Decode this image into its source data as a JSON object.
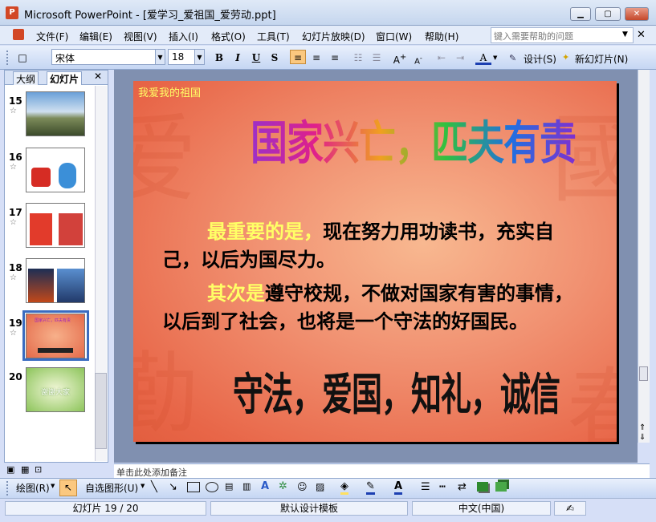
{
  "window": {
    "title": "Microsoft PowerPoint - [爱学习_爱祖国_爱劳动.ppt]",
    "app_icon": "P"
  },
  "menus": [
    "文件(F)",
    "编辑(E)",
    "视图(V)",
    "插入(I)",
    "格式(O)",
    "工具(T)",
    "幻灯片放映(D)",
    "窗口(W)",
    "帮助(H)"
  ],
  "help": {
    "placeholder": "键入需要帮助的问题"
  },
  "toolbar": {
    "font": "宋体",
    "size": "18",
    "bold": "B",
    "italic": "I",
    "underline": "U",
    "shadow": "S",
    "font_color": "A",
    "design": "设计(S)",
    "new_slide": "新幻灯片(N)"
  },
  "tabs": {
    "outline": "大纲",
    "slides": "幻灯片"
  },
  "thumbnails": [
    {
      "num": "15",
      "label": ""
    },
    {
      "num": "16",
      "label": ""
    },
    {
      "num": "17",
      "label": ""
    },
    {
      "num": "18",
      "label": ""
    },
    {
      "num": "19",
      "label": "国家兴亡，匹夫有责"
    },
    {
      "num": "20",
      "label": "谢谢大家"
    }
  ],
  "slide": {
    "corner": "我爱我的祖国",
    "headline": "国家兴亡，匹夫有责",
    "p1_lead": "最重要的是，",
    "p1_rest": "现在努力用功读书，充实自己，以后为国尽力。",
    "p2_lead": "其次是",
    "p2_rest": "遵守校规，不做对国家有害的事情，以后到了社会，也将是一个守法的好国民。",
    "motto": "守法，爱国，知礼，诚信"
  },
  "notes": {
    "placeholder": "单击此处添加备注"
  },
  "drawbar": {
    "draw": "绘图(R)",
    "autoshape": "自选图形(U)"
  },
  "status": {
    "slide": "幻灯片 19 / 20",
    "template": "默认设计模板",
    "lang": "中文(中国)"
  },
  "colors": {
    "slide_bg": "#f19272",
    "highlight": "#ffff66"
  }
}
